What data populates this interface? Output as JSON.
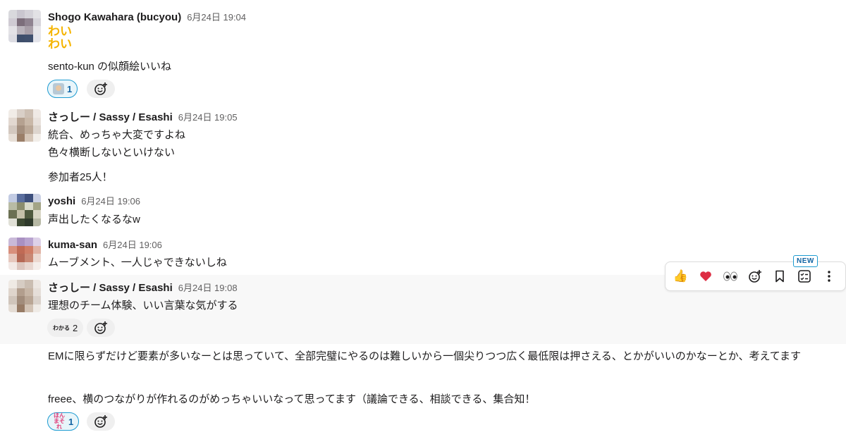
{
  "messages": [
    {
      "author": "Shogo Kawahara (bucyou)",
      "time": "6月24日 19:04",
      "sticker": "わいわい",
      "lines": [
        "sento-kun の似顔絵いいね"
      ],
      "reactions": [
        {
          "emoji": "person-avatar-emoji",
          "count": "1"
        }
      ]
    },
    {
      "author": "さっしー / Sassy / Esashi",
      "time": "6月24日 19:05",
      "lines": [
        "統合、めっちゃ大変ですよね",
        "色々横断しないといけない",
        "参加者25人！"
      ]
    },
    {
      "author": "yoshi",
      "time": "6月24日 19:06",
      "lines": [
        "声出したくなるなw"
      ]
    },
    {
      "author": "kuma-san",
      "time": "6月24日 19:06",
      "lines": [
        "ムーブメント、一人じゃできないしね"
      ]
    },
    {
      "author": "さっしー / Sassy / Esashi",
      "time": "6月24日 19:08",
      "lines": [
        "理想のチーム体験、いい言葉な気がする"
      ],
      "reactions": [
        {
          "emoji_text": "わかる",
          "count": "2"
        }
      ]
    },
    {
      "lines": [
        "EMに限らずだけど要素が多いなーとは思っていて、全部完璧にやるのは難しいから一個尖りつつ広く最低限は押さえる、とかがいいのかなーとか、考えてます",
        "freee、横のつながりが作れるのがめっちゃいいなって思ってます（議論できる、相談できる、集合知！"
      ],
      "reactions": [
        {
          "emoji_text": "ほんまそれ",
          "count": "1"
        }
      ]
    }
  ],
  "toolbar": {
    "new_badge": "NEW",
    "actions": [
      "thumbs-up",
      "heart",
      "eyes",
      "add-reaction",
      "save",
      "create-task",
      "more-actions"
    ]
  },
  "colors": {
    "link_blue": "#1264a3",
    "reaction_border": "#1d9bd1",
    "hover_bg": "#f8f8f8",
    "sticker_yellow": "#f5b400"
  }
}
